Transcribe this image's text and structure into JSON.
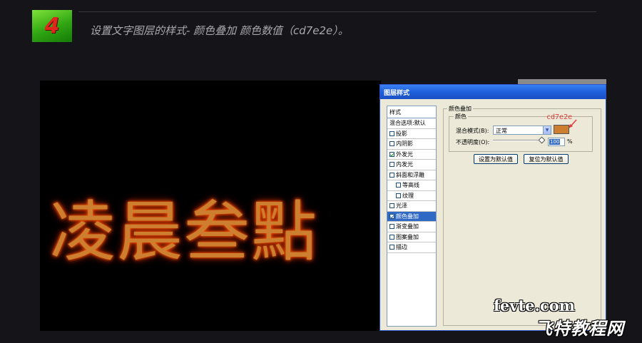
{
  "header": {
    "step_number": "4",
    "instruction": "设置文字图层的样式- 颜色叠加 颜色数值（cd7e2e）。"
  },
  "canvas": {
    "text": "凌晨叁點",
    "text_color": "#cd7e2e",
    "glow_color": "#ff5a00"
  },
  "dialog": {
    "title": "图层样式",
    "style_list_header": "样式",
    "style_items": [
      {
        "label": "混合选项:默认",
        "checkbox": false,
        "checked": false,
        "indent": false,
        "selected": false
      },
      {
        "label": "投影",
        "checkbox": true,
        "checked": false,
        "indent": false,
        "selected": false
      },
      {
        "label": "内阴影",
        "checkbox": true,
        "checked": false,
        "indent": false,
        "selected": false
      },
      {
        "label": "外发光",
        "checkbox": true,
        "checked": true,
        "indent": false,
        "selected": false
      },
      {
        "label": "内发光",
        "checkbox": true,
        "checked": false,
        "indent": false,
        "selected": false
      },
      {
        "label": "斜面和浮雕",
        "checkbox": true,
        "checked": false,
        "indent": false,
        "selected": false
      },
      {
        "label": "等高线",
        "checkbox": true,
        "checked": false,
        "indent": true,
        "selected": false
      },
      {
        "label": "纹理",
        "checkbox": true,
        "checked": false,
        "indent": true,
        "selected": false
      },
      {
        "label": "光泽",
        "checkbox": true,
        "checked": false,
        "indent": false,
        "selected": false
      },
      {
        "label": "颜色叠加",
        "checkbox": true,
        "checked": true,
        "indent": false,
        "selected": true
      },
      {
        "label": "渐变叠加",
        "checkbox": true,
        "checked": false,
        "indent": false,
        "selected": false
      },
      {
        "label": "图案叠加",
        "checkbox": true,
        "checked": false,
        "indent": false,
        "selected": false
      },
      {
        "label": "描边",
        "checkbox": true,
        "checked": false,
        "indent": false,
        "selected": false
      }
    ],
    "section_title": "颜色叠加",
    "group_title": "颜色",
    "blend_mode_label": "混合模式(B):",
    "blend_mode_value": "正常",
    "opacity_label": "不透明度(O):",
    "opacity_value": "100",
    "opacity_unit": "%",
    "opacity_fraction": 1.0,
    "color_swatch": "#cd7e2e",
    "hex_annotation": "cd7e2e",
    "set_default_button": "设置为默认值",
    "reset_default_button": "复位为默认值"
  },
  "watermark": {
    "site": "fevte.com",
    "name": "飞特教程网"
  }
}
